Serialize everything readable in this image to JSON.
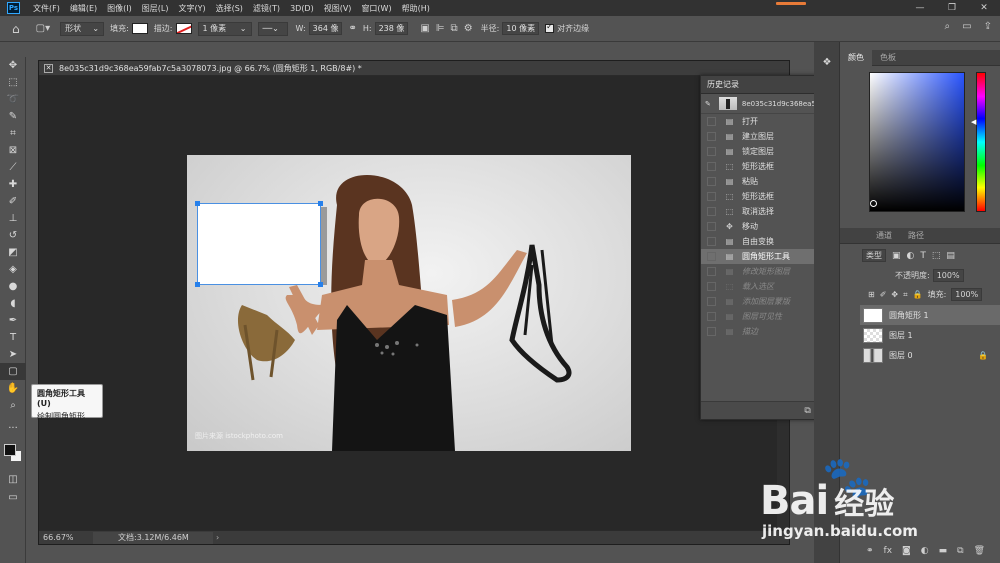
{
  "app": {
    "logo": "Ps",
    "menu": [
      "文件(F)",
      "编辑(E)",
      "图像(I)",
      "图层(L)",
      "文字(Y)",
      "选择(S)",
      "滤镜(T)",
      "3D(D)",
      "视图(V)",
      "窗口(W)",
      "帮助(H)"
    ],
    "window_controls": [
      "—",
      "❐",
      "✕"
    ],
    "accent_color": "#31a8ff"
  },
  "options": {
    "mode": "形状",
    "fill_label": "填充:",
    "stroke_label": "描边:",
    "stroke_width": "1 像素",
    "w_label": "W:",
    "w_value": "364 像",
    "h_label": "H:",
    "h_value": "238 像",
    "radius_label": "半径:",
    "radius_value": "10 像素",
    "align_edges_label": "对齐边缘"
  },
  "tooltip": {
    "title": "圆角矩形工具 (U)",
    "desc": "绘制圆角矩形"
  },
  "document": {
    "tab_title": "8e035c31d9c368ea59fab7c5a3078073.jpg @ 66.7% (圆角矩形 1, RGB/8#) *",
    "zoom": "66.67%",
    "doc_size": "文档:3.12M/6.46M",
    "photo_watermark": "图片来源 istockphoto.com"
  },
  "history": {
    "title": "历史记录",
    "snapshot": "8e035c31d9c368ea59fab7c5a3...",
    "items": [
      {
        "label": "打开",
        "icon": "doc-icon",
        "state": "normal"
      },
      {
        "label": "建立图层",
        "icon": "doc-icon",
        "state": "normal"
      },
      {
        "label": "锁定图层",
        "icon": "doc-icon",
        "state": "normal"
      },
      {
        "label": "矩形选框",
        "icon": "marquee-icon",
        "state": "normal"
      },
      {
        "label": "粘贴",
        "icon": "doc-icon",
        "state": "normal"
      },
      {
        "label": "矩形选框",
        "icon": "marquee-icon",
        "state": "normal"
      },
      {
        "label": "取消选择",
        "icon": "marquee-icon",
        "state": "normal"
      },
      {
        "label": "移动",
        "icon": "move-icon",
        "state": "normal"
      },
      {
        "label": "自由变换",
        "icon": "doc-icon",
        "state": "normal"
      },
      {
        "label": "圆角矩形工具",
        "icon": "doc-icon",
        "state": "active"
      },
      {
        "label": "修改矩形图层",
        "icon": "doc-icon",
        "state": "dim"
      },
      {
        "label": "载入选区",
        "icon": "marquee-icon",
        "state": "dim"
      },
      {
        "label": "添加图层蒙版",
        "icon": "doc-icon",
        "state": "dim"
      },
      {
        "label": "图层可见性",
        "icon": "doc-icon",
        "state": "dim"
      },
      {
        "label": "描边",
        "icon": "doc-icon",
        "state": "dim"
      }
    ]
  },
  "panels": {
    "color_tabs": [
      "颜色",
      "色板"
    ],
    "layer_tabs": [
      "通道",
      "路径"
    ],
    "kind_label": "类型",
    "opacity_label": "不透明度:",
    "opacity_value": "100%",
    "fill_label": "填充:",
    "fill_value": "100%",
    "lock_label": "锁定:",
    "layers": [
      {
        "name": "圆角矩形 1",
        "thumb": "white",
        "active": true
      },
      {
        "name": "图层 1",
        "thumb": "checker",
        "active": false
      },
      {
        "name": "图层 0",
        "thumb": "photo",
        "active": false
      }
    ]
  },
  "watermark": {
    "brand": "Bai",
    "brand_tail": "经验",
    "url": "jingyan.baidu.com"
  }
}
